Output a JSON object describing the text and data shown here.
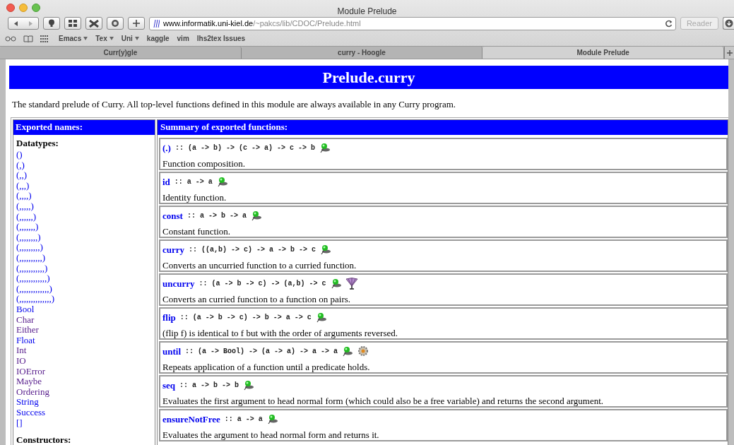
{
  "window": {
    "title": "Module Prelude"
  },
  "toolbar": {
    "url_host": "www.informatik.uni-kiel.de",
    "url_path": "/~pakcs/lib/CDOC/Prelude.html",
    "reader": "Reader"
  },
  "bookmarks": [
    {
      "label": "Emacs",
      "menu": true
    },
    {
      "label": "Tex",
      "menu": true
    },
    {
      "label": "Uni",
      "menu": true
    },
    {
      "label": "kaggle",
      "menu": false
    },
    {
      "label": "vim",
      "menu": false
    },
    {
      "label": "lhs2tex Issues",
      "menu": false
    }
  ],
  "tabs": [
    {
      "label": "Curr(y)gle",
      "selected": false
    },
    {
      "label": "curry - Hoogle",
      "selected": false
    },
    {
      "label": "Module Prelude",
      "selected": true
    }
  ],
  "page": {
    "heading": "Prelude.curry",
    "intro": "The standard prelude of Curry. All top-level functions defined in this module are always available in any Curry program.",
    "exported_header": "Exported names:",
    "datatypes_label": "Datatypes:",
    "datatypes": [
      {
        "name": "()",
        "visited": false
      },
      {
        "name": "(,)",
        "visited": false
      },
      {
        "name": "(,,)",
        "visited": false
      },
      {
        "name": "(,,,)",
        "visited": false
      },
      {
        "name": "(,,,,)",
        "visited": false
      },
      {
        "name": "(,,,,,)",
        "visited": false
      },
      {
        "name": "(,,,,,,)",
        "visited": false
      },
      {
        "name": "(,,,,,,,)",
        "visited": false
      },
      {
        "name": "(,,,,,,,,)",
        "visited": false
      },
      {
        "name": "(,,,,,,,,,)",
        "visited": false
      },
      {
        "name": "(,,,,,,,,,,)",
        "visited": false
      },
      {
        "name": "(,,,,,,,,,,,)",
        "visited": false
      },
      {
        "name": "(,,,,,,,,,,,,)",
        "visited": false
      },
      {
        "name": "(,,,,,,,,,,,,,)",
        "visited": false
      },
      {
        "name": "(,,,,,,,,,,,,,,)",
        "visited": false
      },
      {
        "name": "Bool",
        "visited": false
      },
      {
        "name": "Char",
        "visited": true
      },
      {
        "name": "Either",
        "visited": true
      },
      {
        "name": "Float",
        "visited": false
      },
      {
        "name": "Int",
        "visited": true
      },
      {
        "name": "IO",
        "visited": true
      },
      {
        "name": "IOError",
        "visited": true
      },
      {
        "name": "Maybe",
        "visited": true
      },
      {
        "name": "Ordering",
        "visited": true
      },
      {
        "name": "String",
        "visited": false
      },
      {
        "name": "Success",
        "visited": false
      },
      {
        "name": "[]",
        "visited": false
      }
    ],
    "constructors_label": "Constructors:",
    "summary_header": "Summary of exported functions:",
    "functions": [
      {
        "name": "(.)",
        "signature": ":: (a -> b) -> (c -> a) -> c -> b",
        "icons": [
          {
            "kind": "pin"
          }
        ],
        "description": "Function composition."
      },
      {
        "name": "id",
        "signature": ":: a -> a",
        "icons": [
          {
            "kind": "pin"
          }
        ],
        "description": "Identity function."
      },
      {
        "name": "const",
        "signature": ":: a -> b -> a",
        "icons": [
          {
            "kind": "pin"
          }
        ],
        "description": "Constant function."
      },
      {
        "name": "curry",
        "signature": ":: ((a,b) -> c) -> a -> b -> c",
        "icons": [
          {
            "kind": "pin"
          }
        ],
        "description": "Converts an uncurried function to a curried function."
      },
      {
        "name": "uncurry",
        "signature": ":: (a -> b -> c) -> (a,b) -> c",
        "icons": [
          {
            "kind": "pin"
          },
          {
            "kind": "fan"
          }
        ],
        "description": "Converts an curried function to a function on pairs."
      },
      {
        "name": "flip",
        "signature": ":: (a -> b -> c) -> b -> a -> c",
        "icons": [
          {
            "kind": "pin"
          }
        ],
        "description": "(flip f) is identical to f but with the order of arguments reversed."
      },
      {
        "name": "until",
        "signature": ":: (a -> Bool) -> (a -> a) -> a -> a",
        "icons": [
          {
            "kind": "pin"
          },
          {
            "kind": "gear"
          }
        ],
        "description": "Repeats application of a function until a predicate holds."
      },
      {
        "name": "seq",
        "signature": ":: a -> b -> b",
        "icons": [
          {
            "kind": "pin"
          }
        ],
        "description": "Evaluates the first argument to head normal form (which could also be a free variable) and returns the second argument."
      },
      {
        "name": "ensureNotFree",
        "signature": ":: a -> a",
        "icons": [
          {
            "kind": "pin"
          }
        ],
        "description": "Evaluates the argument to head normal form and returns it."
      }
    ]
  }
}
